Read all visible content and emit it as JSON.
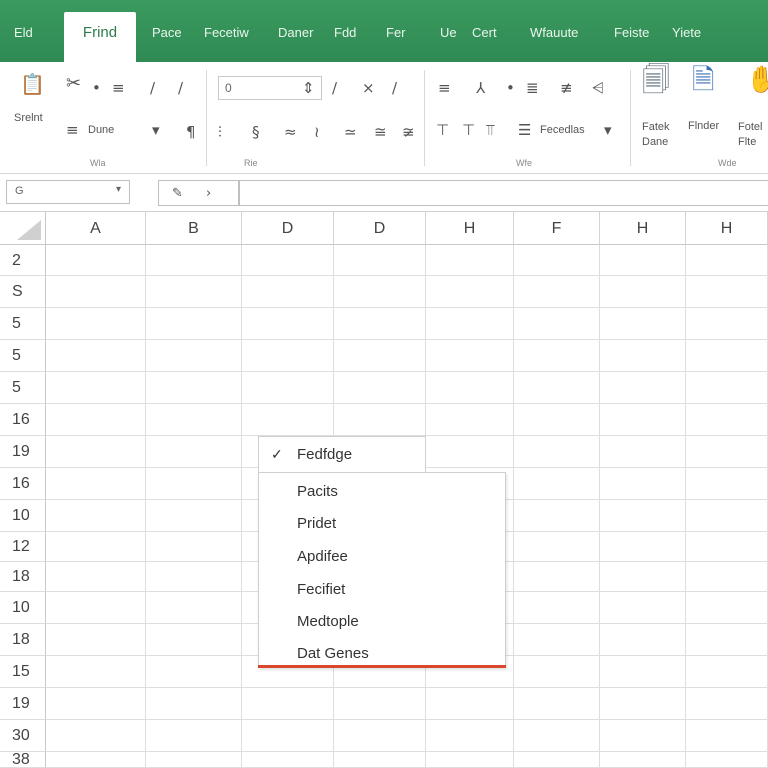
{
  "tabs": [
    {
      "label": "Eld",
      "active": false
    },
    {
      "label": "Frind",
      "active": true
    },
    {
      "label": "Pace",
      "active": false
    },
    {
      "label": "Fecetiw",
      "active": false
    },
    {
      "label": "Daner",
      "active": false
    },
    {
      "label": "Fdd",
      "active": false
    },
    {
      "label": "Fer",
      "active": false
    },
    {
      "label": "Ue",
      "active": false
    },
    {
      "label": "Cert",
      "active": false
    },
    {
      "label": "Wfauute",
      "active": false
    },
    {
      "label": "Feiste",
      "active": false
    },
    {
      "label": "Yiete",
      "active": false
    }
  ],
  "ribbon": {
    "paste_label": "Srelnt",
    "font_box_value": "0",
    "format_dropdown_label": "Dune",
    "conditional_label": "Fecedlas",
    "format_table_label": "Fatek\nDane",
    "cell_styles_label": "Flnder",
    "editing_label": "Fotel\nFlte",
    "group_labels": [
      "Wla",
      "Rie",
      "Wfe",
      "Wde"
    ]
  },
  "name_box": {
    "value": "G"
  },
  "columns": [
    "A",
    "B",
    "D",
    "D",
    "H",
    "F",
    "H",
    "H"
  ],
  "rows": [
    "2",
    "S",
    "5",
    "5",
    "5",
    "16",
    "19",
    "16",
    "10",
    "12",
    "18",
    "10",
    "18",
    "15",
    "19",
    "30",
    "38"
  ],
  "context_menu": {
    "header_label": "Fedfdge",
    "header_icon": "check-icon",
    "items": [
      "Pacits",
      "Pridet",
      "Apdifee",
      "Fecifiet",
      "Medtople",
      "Dat Genes"
    ],
    "accent_color": "#d9472b"
  },
  "colors": {
    "ribbon_green": "#2f8a53"
  }
}
